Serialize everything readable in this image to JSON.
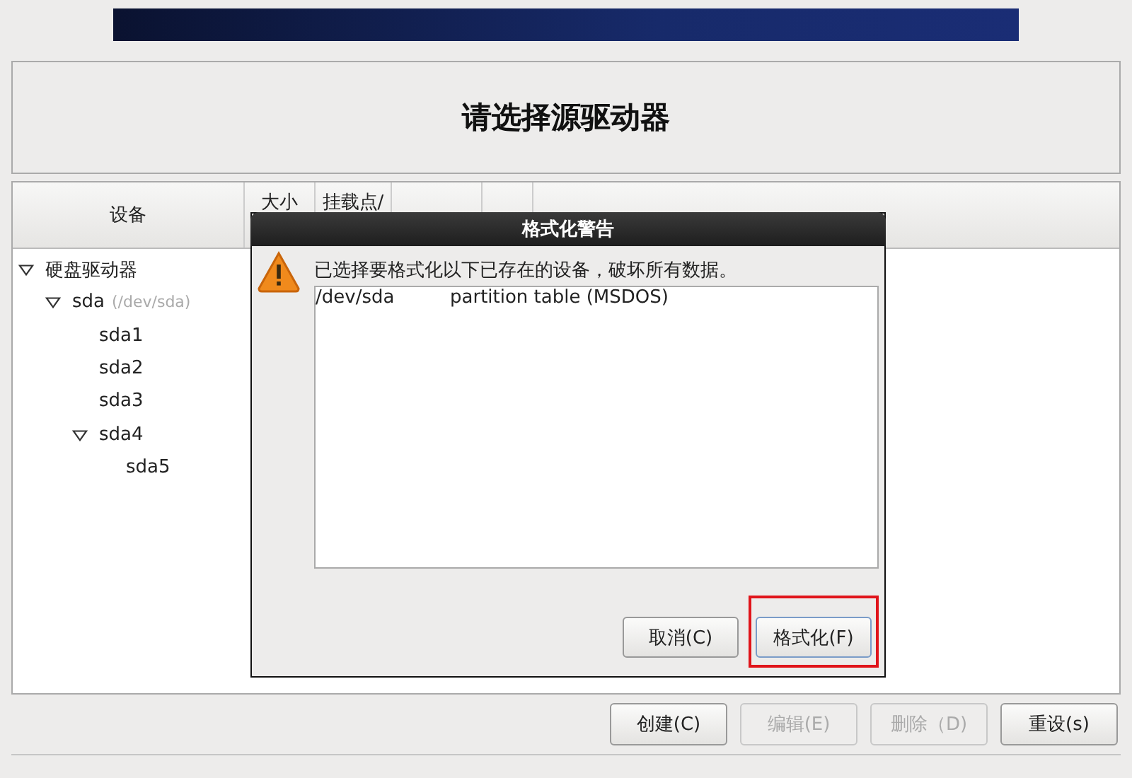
{
  "title": "请选择源驱动器",
  "table": {
    "columns": [
      "设备",
      "大小",
      "挂载点/"
    ],
    "tree": [
      {
        "label": "硬盘驱动器",
        "expanded": true,
        "children": [
          {
            "label": "sda",
            "hint": "(/dev/sda)",
            "expanded": true,
            "children": [
              {
                "label": "sda1"
              },
              {
                "label": "sda2"
              },
              {
                "label": "sda3"
              },
              {
                "label": "sda4",
                "expanded": true,
                "children": [
                  {
                    "label": "sda5"
                  }
                ]
              }
            ]
          }
        ]
      }
    ]
  },
  "dialog": {
    "title": "格式化警告",
    "message": "已选择要格式化以下已存在的设备，破坏所有数据。",
    "rows": [
      {
        "device": "/dev/sda",
        "description": "partition table (MSDOS)"
      }
    ],
    "buttons": [
      {
        "label": "取消(C)",
        "highlighted": false
      },
      {
        "label": "格式化(F)",
        "highlighted": true
      }
    ]
  },
  "buttons": [
    {
      "label": "创建(C)",
      "disabled": false
    },
    {
      "label": "编辑(E)",
      "disabled": true
    },
    {
      "label": "删除（D)",
      "disabled": true
    },
    {
      "label": "重设(s)",
      "disabled": false
    }
  ]
}
